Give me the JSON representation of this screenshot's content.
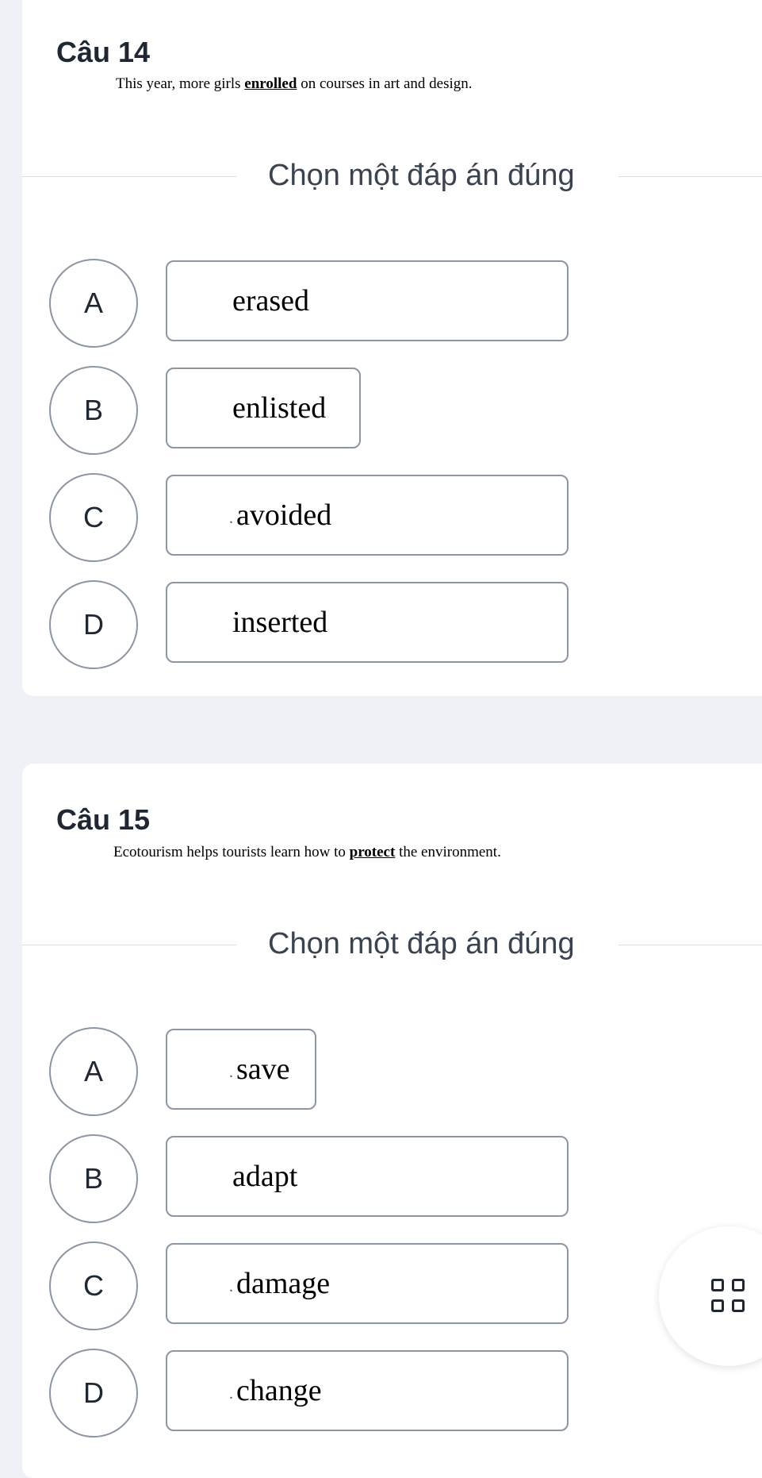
{
  "questions": [
    {
      "title": "Câu 14",
      "text_before": "This year, more girls ",
      "underlined": "enrolled",
      "text_after": " on courses in art and design.",
      "prompt": "Chọn một đáp án đúng",
      "options": [
        {
          "letter": "A",
          "prefix": "",
          "text": "erased"
        },
        {
          "letter": "B",
          "prefix": "",
          "text": "enlisted"
        },
        {
          "letter": "C",
          "prefix": ".",
          "text": "avoided"
        },
        {
          "letter": "D",
          "prefix": "",
          "text": "inserted"
        }
      ]
    },
    {
      "title": "Câu 15",
      "text_before": "Ecotourism helps tourists learn how to ",
      "underlined": "protect",
      "text_after": " the environment.",
      "prompt": "Chọn một đáp án đúng",
      "options": [
        {
          "letter": "A",
          "prefix": ".",
          "text": "save"
        },
        {
          "letter": "B",
          "prefix": "",
          "text": "adapt"
        },
        {
          "letter": "C",
          "prefix": ".",
          "text": "damage"
        },
        {
          "letter": "D",
          "prefix": ".",
          "text": "change"
        }
      ]
    }
  ],
  "floating_button": {
    "icon": "grid-icon"
  }
}
